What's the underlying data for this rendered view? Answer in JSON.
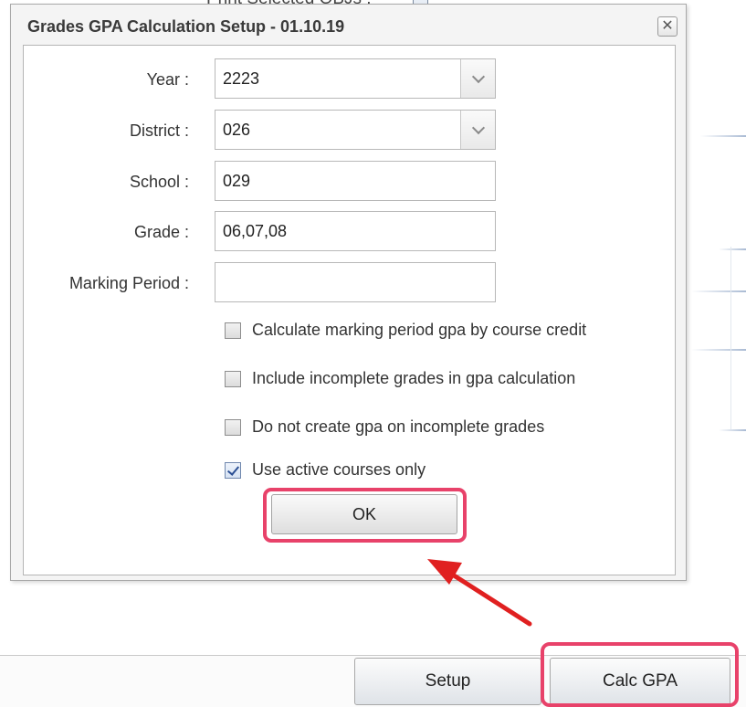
{
  "background": {
    "top_text": "Print Selected OBJs :"
  },
  "dialog": {
    "title": "Grades GPA Calculation Setup - 01.10.19",
    "close_glyph": "✕",
    "fields": {
      "year": {
        "label": "Year :",
        "value": "2223"
      },
      "district": {
        "label": "District :",
        "value": "026"
      },
      "school": {
        "label": "School :",
        "value": "029"
      },
      "grade": {
        "label": "Grade :",
        "value": "06,07,08"
      },
      "marking_period": {
        "label": "Marking Period :",
        "value": ""
      }
    },
    "options": [
      {
        "label": "Calculate marking period gpa by course credit",
        "checked": false
      },
      {
        "label": "Include incomplete grades in gpa calculation",
        "checked": false
      },
      {
        "label": "Do not create gpa on incomplete grades",
        "checked": false
      },
      {
        "label": "Use active courses only",
        "checked": true
      }
    ],
    "ok_label": "OK"
  },
  "toolbar": {
    "setup_label": "Setup",
    "calc_gpa_label": "Calc GPA"
  },
  "colors": {
    "highlight": "#e8426a",
    "arrow": "#e02020"
  },
  "icons": {
    "close": "close-icon",
    "dropdown": "chevron-down-icon",
    "check": "checkmark-icon",
    "annotation": "red-arrow-icon"
  }
}
